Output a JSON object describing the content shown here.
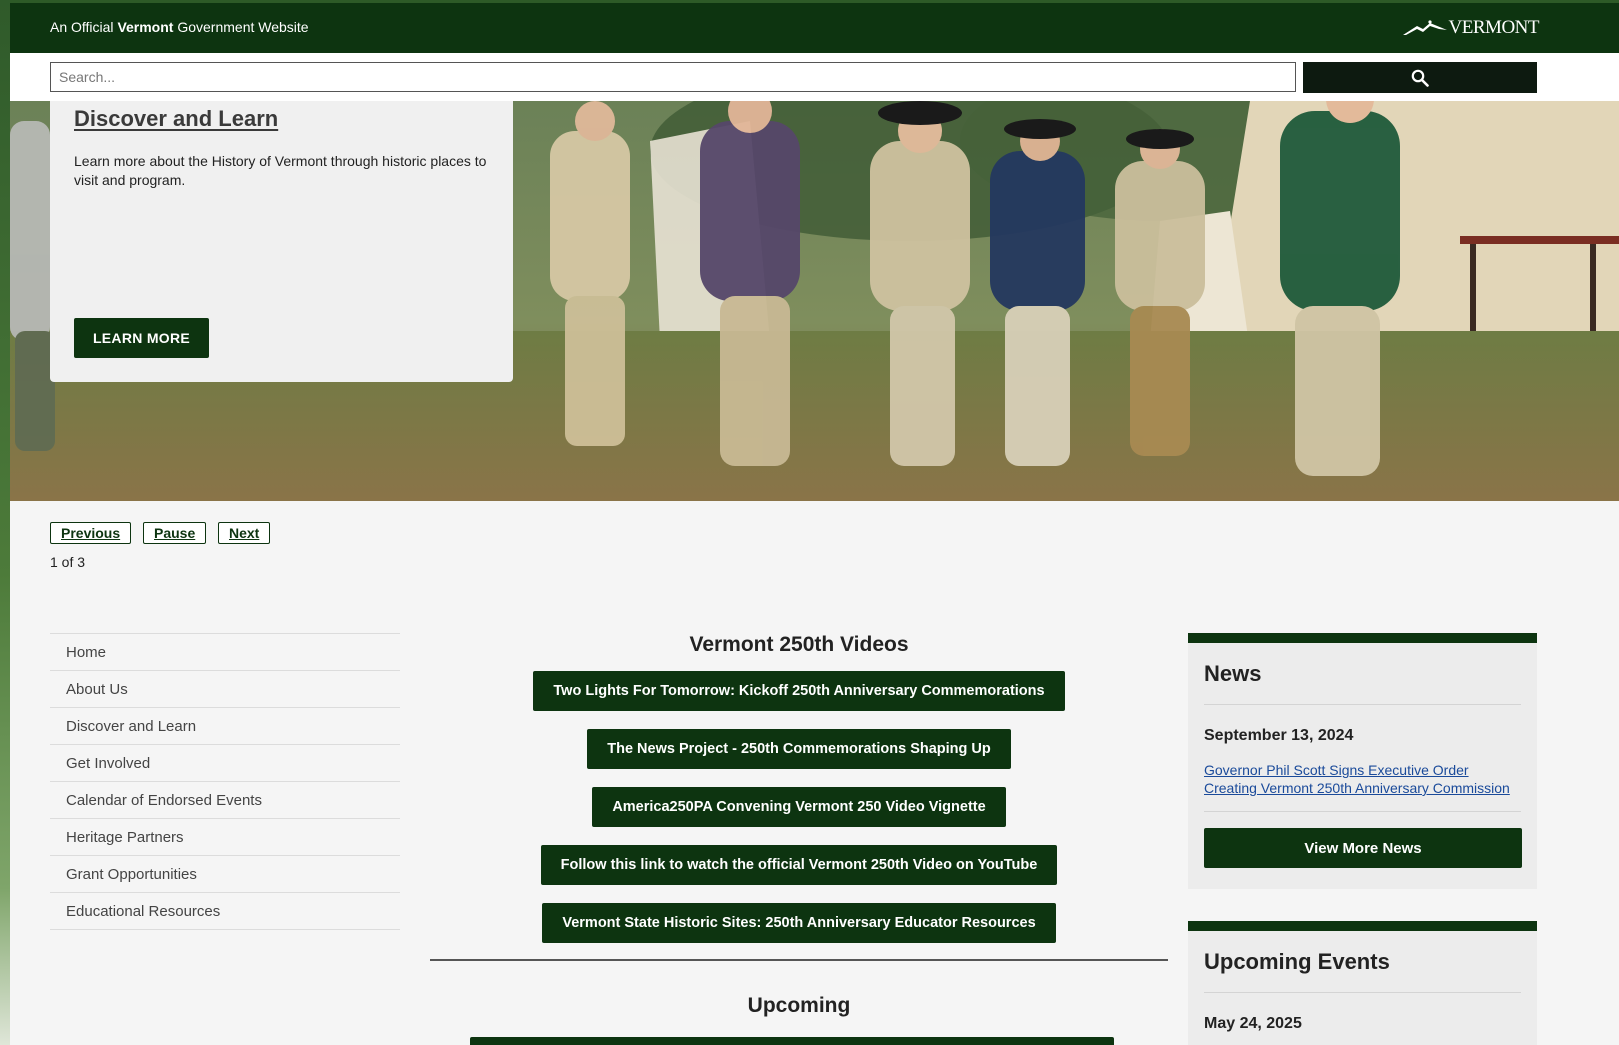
{
  "gov_bar": {
    "prefix": "An Official ",
    "state": "Vermont",
    "suffix": " Government Website",
    "logo_text": "VERMONT"
  },
  "search": {
    "placeholder": "Search...",
    "value": ""
  },
  "hero": {
    "title": "Discover and Learn",
    "description": "Learn more about the History of Vermont through historic places to visit and program.",
    "button_label": "LEARN MORE"
  },
  "carousel": {
    "previous_label": "Previous",
    "pause_label": "Pause",
    "next_label": "Next",
    "counter": "1 of 3"
  },
  "nav": {
    "items": [
      {
        "label": "Home"
      },
      {
        "label": "About Us"
      },
      {
        "label": "Discover and Learn"
      },
      {
        "label": "Get Involved"
      },
      {
        "label": "Calendar of Endorsed Events"
      },
      {
        "label": "Heritage Partners"
      },
      {
        "label": "Grant Opportunities"
      },
      {
        "label": "Educational Resources"
      }
    ]
  },
  "videos": {
    "title": "Vermont 250th Videos",
    "links": [
      {
        "label": "Two Lights For Tomorrow: Kickoff 250th Anniversary Commemorations"
      },
      {
        "label": "The News Project - 250th Commemorations Shaping Up"
      },
      {
        "label": "America250PA Convening Vermont 250 Video Vignette"
      },
      {
        "label": "Follow this link to watch the official Vermont 250th Video on YouTube"
      },
      {
        "label": "Vermont State Historic Sites: 250th Anniversary Educator Resources"
      }
    ]
  },
  "upcoming": {
    "title": "Upcoming"
  },
  "news": {
    "title": "News",
    "date": "September 13, 2024",
    "link": "Governor Phil Scott Signs Executive Order Creating Vermont 250th Anniversary Commission",
    "more_label": "View More News"
  },
  "events": {
    "title": "Upcoming Events",
    "date": "May 24, 2025"
  },
  "colors": {
    "brand_green": "#0d3410",
    "link_blue": "#1a4a9a"
  }
}
